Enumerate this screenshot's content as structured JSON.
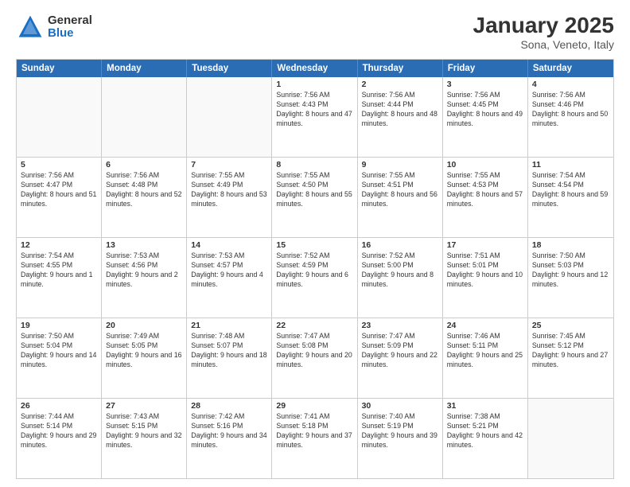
{
  "logo": {
    "general": "General",
    "blue": "Blue"
  },
  "title": {
    "month": "January 2025",
    "location": "Sona, Veneto, Italy"
  },
  "header": {
    "days": [
      "Sunday",
      "Monday",
      "Tuesday",
      "Wednesday",
      "Thursday",
      "Friday",
      "Saturday"
    ]
  },
  "rows": [
    [
      {
        "day": "",
        "info": ""
      },
      {
        "day": "",
        "info": ""
      },
      {
        "day": "",
        "info": ""
      },
      {
        "day": "1",
        "info": "Sunrise: 7:56 AM\nSunset: 4:43 PM\nDaylight: 8 hours and 47 minutes."
      },
      {
        "day": "2",
        "info": "Sunrise: 7:56 AM\nSunset: 4:44 PM\nDaylight: 8 hours and 48 minutes."
      },
      {
        "day": "3",
        "info": "Sunrise: 7:56 AM\nSunset: 4:45 PM\nDaylight: 8 hours and 49 minutes."
      },
      {
        "day": "4",
        "info": "Sunrise: 7:56 AM\nSunset: 4:46 PM\nDaylight: 8 hours and 50 minutes."
      }
    ],
    [
      {
        "day": "5",
        "info": "Sunrise: 7:56 AM\nSunset: 4:47 PM\nDaylight: 8 hours and 51 minutes."
      },
      {
        "day": "6",
        "info": "Sunrise: 7:56 AM\nSunset: 4:48 PM\nDaylight: 8 hours and 52 minutes."
      },
      {
        "day": "7",
        "info": "Sunrise: 7:55 AM\nSunset: 4:49 PM\nDaylight: 8 hours and 53 minutes."
      },
      {
        "day": "8",
        "info": "Sunrise: 7:55 AM\nSunset: 4:50 PM\nDaylight: 8 hours and 55 minutes."
      },
      {
        "day": "9",
        "info": "Sunrise: 7:55 AM\nSunset: 4:51 PM\nDaylight: 8 hours and 56 minutes."
      },
      {
        "day": "10",
        "info": "Sunrise: 7:55 AM\nSunset: 4:53 PM\nDaylight: 8 hours and 57 minutes."
      },
      {
        "day": "11",
        "info": "Sunrise: 7:54 AM\nSunset: 4:54 PM\nDaylight: 8 hours and 59 minutes."
      }
    ],
    [
      {
        "day": "12",
        "info": "Sunrise: 7:54 AM\nSunset: 4:55 PM\nDaylight: 9 hours and 1 minute."
      },
      {
        "day": "13",
        "info": "Sunrise: 7:53 AM\nSunset: 4:56 PM\nDaylight: 9 hours and 2 minutes."
      },
      {
        "day": "14",
        "info": "Sunrise: 7:53 AM\nSunset: 4:57 PM\nDaylight: 9 hours and 4 minutes."
      },
      {
        "day": "15",
        "info": "Sunrise: 7:52 AM\nSunset: 4:59 PM\nDaylight: 9 hours and 6 minutes."
      },
      {
        "day": "16",
        "info": "Sunrise: 7:52 AM\nSunset: 5:00 PM\nDaylight: 9 hours and 8 minutes."
      },
      {
        "day": "17",
        "info": "Sunrise: 7:51 AM\nSunset: 5:01 PM\nDaylight: 9 hours and 10 minutes."
      },
      {
        "day": "18",
        "info": "Sunrise: 7:50 AM\nSunset: 5:03 PM\nDaylight: 9 hours and 12 minutes."
      }
    ],
    [
      {
        "day": "19",
        "info": "Sunrise: 7:50 AM\nSunset: 5:04 PM\nDaylight: 9 hours and 14 minutes."
      },
      {
        "day": "20",
        "info": "Sunrise: 7:49 AM\nSunset: 5:05 PM\nDaylight: 9 hours and 16 minutes."
      },
      {
        "day": "21",
        "info": "Sunrise: 7:48 AM\nSunset: 5:07 PM\nDaylight: 9 hours and 18 minutes."
      },
      {
        "day": "22",
        "info": "Sunrise: 7:47 AM\nSunset: 5:08 PM\nDaylight: 9 hours and 20 minutes."
      },
      {
        "day": "23",
        "info": "Sunrise: 7:47 AM\nSunset: 5:09 PM\nDaylight: 9 hours and 22 minutes."
      },
      {
        "day": "24",
        "info": "Sunrise: 7:46 AM\nSunset: 5:11 PM\nDaylight: 9 hours and 25 minutes."
      },
      {
        "day": "25",
        "info": "Sunrise: 7:45 AM\nSunset: 5:12 PM\nDaylight: 9 hours and 27 minutes."
      }
    ],
    [
      {
        "day": "26",
        "info": "Sunrise: 7:44 AM\nSunset: 5:14 PM\nDaylight: 9 hours and 29 minutes."
      },
      {
        "day": "27",
        "info": "Sunrise: 7:43 AM\nSunset: 5:15 PM\nDaylight: 9 hours and 32 minutes."
      },
      {
        "day": "28",
        "info": "Sunrise: 7:42 AM\nSunset: 5:16 PM\nDaylight: 9 hours and 34 minutes."
      },
      {
        "day": "29",
        "info": "Sunrise: 7:41 AM\nSunset: 5:18 PM\nDaylight: 9 hours and 37 minutes."
      },
      {
        "day": "30",
        "info": "Sunrise: 7:40 AM\nSunset: 5:19 PM\nDaylight: 9 hours and 39 minutes."
      },
      {
        "day": "31",
        "info": "Sunrise: 7:38 AM\nSunset: 5:21 PM\nDaylight: 9 hours and 42 minutes."
      },
      {
        "day": "",
        "info": ""
      }
    ]
  ]
}
